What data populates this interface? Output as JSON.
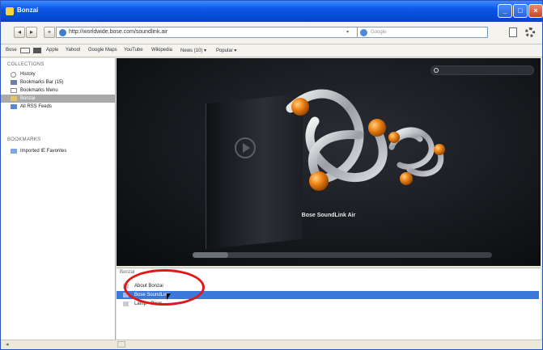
{
  "window": {
    "title": "Bonzai"
  },
  "navbar": {
    "back_label": "◂",
    "forward_label": "▸",
    "home_label": "+",
    "url": "http://worldwide.bose.com/soundlink.air",
    "url_dropdown": "▾",
    "search_placeholder": "Google"
  },
  "bookmarks_bar": {
    "items": [
      "Bose",
      "Apple",
      "Yahoo!",
      "Google Maps",
      "YouTube",
      "Wikipedia",
      "News (10) ▾",
      "Popular ▾"
    ]
  },
  "sidebar": {
    "collections_header": "COLLECTIONS",
    "collections": [
      "History",
      "Bookmarks Bar (15)",
      "Bookmarks Menu",
      "Bonzai",
      "All RSS Feeds"
    ],
    "selected_index": 3,
    "bookmarks_header": "BOOKMARKS",
    "bookmarks": [
      "Imported IE Favorites"
    ]
  },
  "content": {
    "product_title": "Bose SoundLink Air",
    "progress": 0.12
  },
  "info_panel": {
    "header": "Bonzai",
    "rows": [
      "About Bonzai",
      "Bose SoundLink",
      "Lamp - Pixar"
    ],
    "selected_index": 1
  },
  "statusbar": {
    "left": "◂"
  },
  "colors": {
    "title_bar": "#0a56e6",
    "selection": "#3b78d8",
    "annotation": "#e01818",
    "logo_orange": "#f28a1a"
  }
}
